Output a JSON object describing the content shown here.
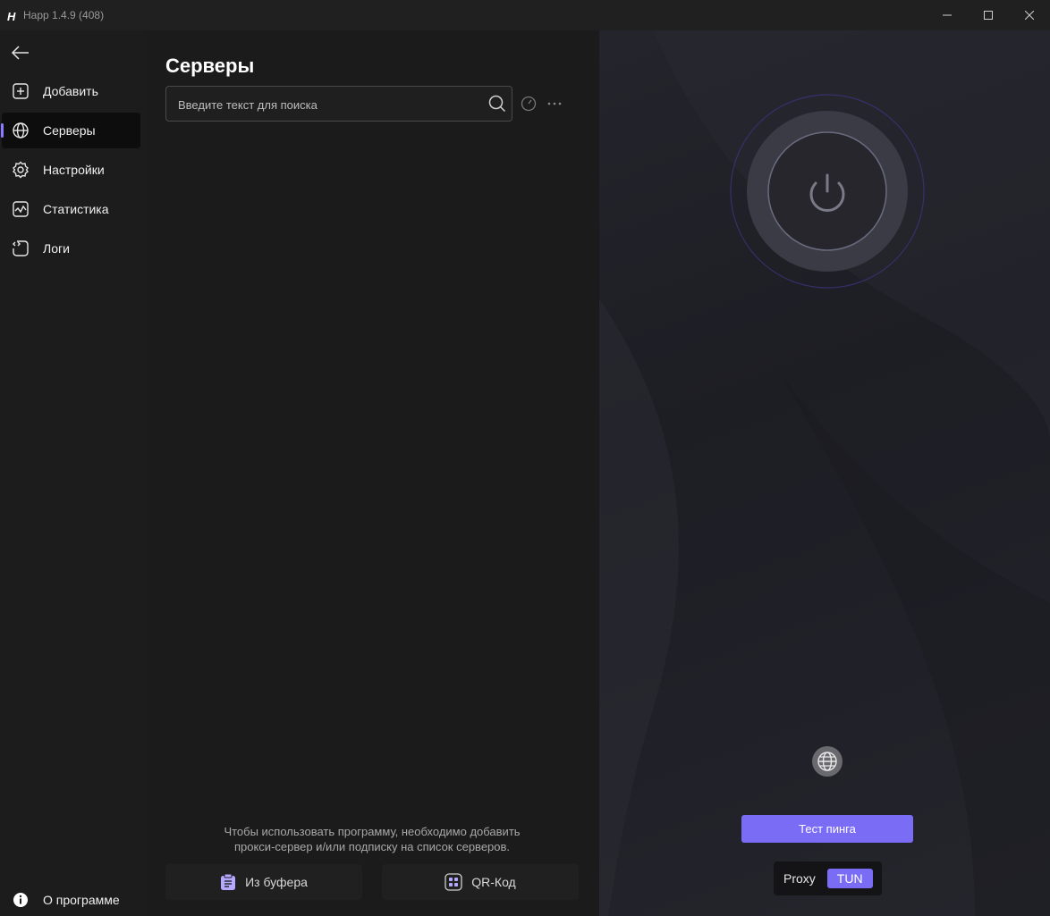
{
  "window": {
    "title": "Happ 1.4.9 (408)"
  },
  "sidebar": {
    "items": [
      {
        "label": "Добавить",
        "icon": "plus-square-icon"
      },
      {
        "label": "Серверы",
        "icon": "globe-icon",
        "active": true
      },
      {
        "label": "Настройки",
        "icon": "gear-icon"
      },
      {
        "label": "Статистика",
        "icon": "chart-line-icon"
      },
      {
        "label": "Логи",
        "icon": "logs-icon"
      }
    ],
    "about_label": "О программе"
  },
  "servers": {
    "title": "Серверы",
    "search_placeholder": "Введите текст для поиска",
    "empty_message_line1": "Чтобы использовать программу, необходимо добавить",
    "empty_message_line2": "прокси-сервер и/или подписку на список серверов.",
    "from_clipboard_label": "Из буфера",
    "qr_label": "QR-Код"
  },
  "connection": {
    "ping_test_label": "Тест пинга",
    "modes": [
      "Proxy",
      "TUN"
    ],
    "selected_mode": "TUN"
  },
  "colors": {
    "accent": "#7b6cf6",
    "background": "#1c1c1c"
  }
}
